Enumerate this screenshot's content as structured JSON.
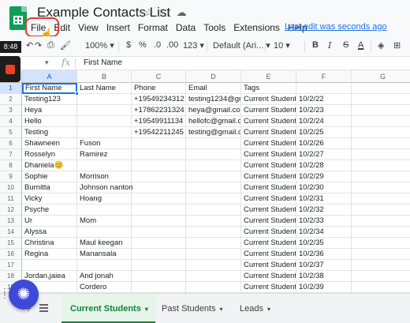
{
  "app": {
    "title": "Example Contacts List",
    "last_edit": "Last edit was seconds ago",
    "time_badge": "8:48"
  },
  "menu": [
    "File",
    "Edit",
    "View",
    "Insert",
    "Format",
    "Data",
    "Tools",
    "Extensions",
    "Help"
  ],
  "toolbar": {
    "zoom": "100%",
    "currency": "$",
    "percent": "%",
    "decrease_decimal": ".0",
    "increase_decimal": ".00",
    "more_formats": "123",
    "font": "Default (Ari...",
    "font_size": "10",
    "bold": "B",
    "italic": "I",
    "strikethrough": "S",
    "text_color": "A"
  },
  "formula_bar": {
    "fx": "fx",
    "value": "First Name"
  },
  "columns": [
    "A",
    "B",
    "C",
    "D",
    "E",
    "F",
    "G"
  ],
  "rows": [
    {
      "n": "1",
      "cells": [
        "First Name",
        "Last Name",
        "Phone",
        "Email",
        "Tags",
        "",
        ""
      ]
    },
    {
      "n": "2",
      "cells": [
        "Testing123",
        "",
        "+19549234312",
        "testing1234@gm",
        "Current Student",
        "10/2/22",
        ""
      ]
    },
    {
      "n": "3",
      "cells": [
        "Heya",
        "",
        "+17862231324",
        "heya@gmail.con",
        "Current Student",
        "10/2/23",
        ""
      ]
    },
    {
      "n": "4",
      "cells": [
        "Hello",
        "",
        "+19549911134",
        "hellofc@gmail.co",
        "Current Student",
        "10/2/24",
        ""
      ]
    },
    {
      "n": "5",
      "cells": [
        "Testing",
        "",
        "+19542211245",
        "testing@gmail.co",
        "Current Student",
        "10/2/25",
        ""
      ]
    },
    {
      "n": "6",
      "cells": [
        "Shawneen",
        "Fuson",
        "",
        "",
        "Current Student",
        "10/2/26",
        ""
      ]
    },
    {
      "n": "7",
      "cells": [
        "Rosselyn",
        "Ramirez",
        "",
        "",
        "Current Student",
        "10/2/27",
        ""
      ]
    },
    {
      "n": "8",
      "cells": [
        "Dhaniela😊",
        "",
        "",
        "",
        "Current Student",
        "10/2/28",
        ""
      ]
    },
    {
      "n": "9",
      "cells": [
        "Sophie",
        "Morrison",
        "",
        "",
        "Current Student",
        "10/2/29",
        ""
      ]
    },
    {
      "n": "10",
      "cells": [
        "Burnitta",
        "Johnson nanton",
        "",
        "",
        "Current Student",
        "10/2/30",
        ""
      ]
    },
    {
      "n": "11",
      "cells": [
        "Vicky",
        "Hoang",
        "",
        "",
        "Current Student",
        "10/2/31",
        ""
      ]
    },
    {
      "n": "12",
      "cells": [
        "Psyche",
        "",
        "",
        "",
        "Current Student",
        "10/2/32",
        ""
      ]
    },
    {
      "n": "13",
      "cells": [
        "Ur",
        "Mom",
        "",
        "",
        "Current Student",
        "10/2/33",
        ""
      ]
    },
    {
      "n": "14",
      "cells": [
        "Alyssa",
        "",
        "",
        "",
        "Current Student",
        "10/2/34",
        ""
      ]
    },
    {
      "n": "15",
      "cells": [
        "Christina",
        "Maul keegan",
        "",
        "",
        "Current Student",
        "10/2/35",
        ""
      ]
    },
    {
      "n": "16",
      "cells": [
        "Regina",
        "Manansala",
        "",
        "",
        "Current Student",
        "10/2/36",
        ""
      ]
    },
    {
      "n": "17",
      "cells": [
        "",
        "",
        "",
        "",
        "Current Student",
        "10/2/37",
        ""
      ]
    },
    {
      "n": "18",
      "cells": [
        "Jordan,jaiea",
        "And jonah",
        "",
        "",
        "Current Student",
        "10/2/38",
        ""
      ]
    },
    {
      "n": "19",
      "cells": [
        "",
        "Cordero",
        "",
        "",
        "Current Student",
        "10/2/39",
        ""
      ]
    }
  ],
  "sheets": [
    {
      "label": "Current Students",
      "active": true
    },
    {
      "label": "Past Students",
      "active": false
    },
    {
      "label": "Leads",
      "active": false
    }
  ],
  "colors": {
    "accent": "#1a73e8",
    "sheets_green": "#0f9d58",
    "highlight_ring": "#e53935",
    "fab": "#3d49d8"
  }
}
